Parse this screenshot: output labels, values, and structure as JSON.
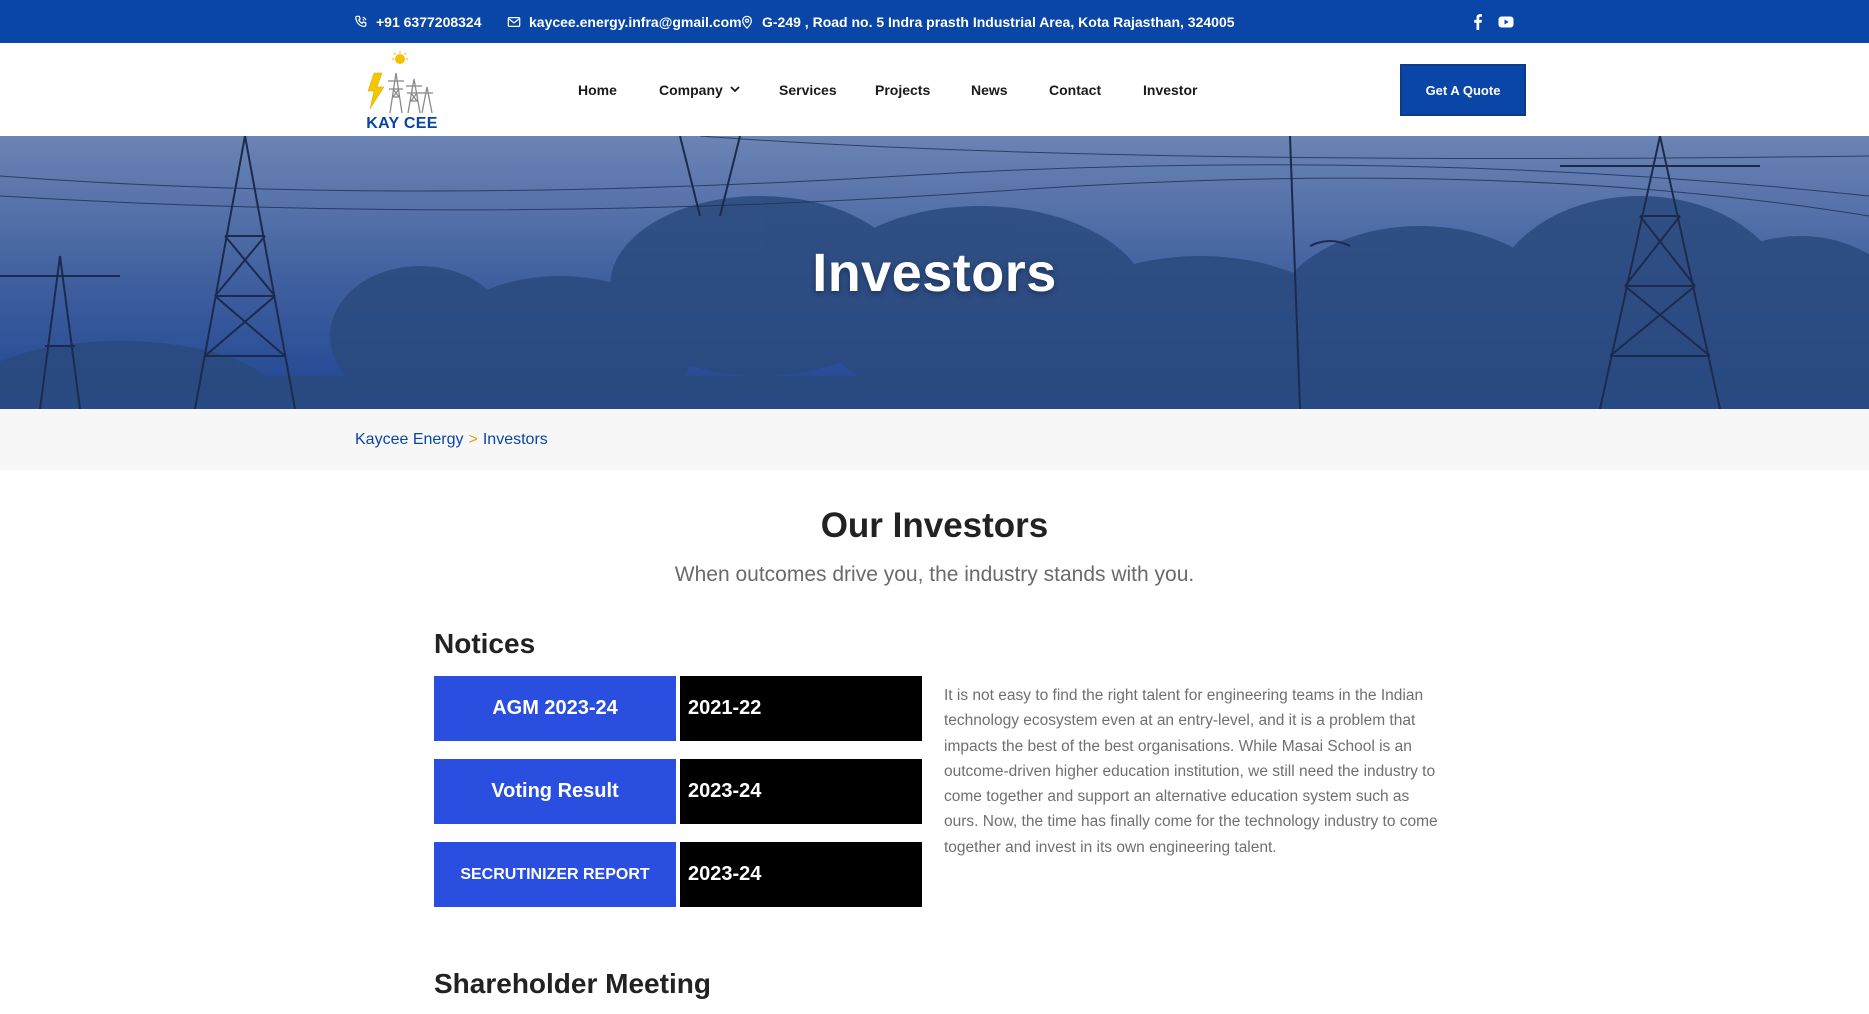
{
  "topbar": {
    "phone": "+91 6377208324",
    "email": "kaycee.energy.infra@gmail.com",
    "address": "G-249 , Road no. 5 Indra prasth Industrial Area, Kota Rajasthan, 324005",
    "icons": [
      "phone-icon",
      "mail-icon",
      "location-pin-icon",
      "facebook-icon",
      "youtube-icon"
    ]
  },
  "header": {
    "logo_text": "KAY CEE",
    "nav": [
      {
        "label": "Home"
      },
      {
        "label": "Company",
        "has_dropdown": true
      },
      {
        "label": "Services"
      },
      {
        "label": "Projects"
      },
      {
        "label": "News"
      },
      {
        "label": "Contact"
      },
      {
        "label": "Investor"
      }
    ],
    "cta": "Get A Quote"
  },
  "hero": {
    "title": "Investors"
  },
  "breadcrumb": {
    "home": "Kaycee Energy",
    "separator": ">",
    "current": "Investors"
  },
  "main": {
    "title": "Our Investors",
    "subtitle": "When outcomes drive you, the industry stands with you.",
    "notices_heading": "Notices",
    "notices": [
      {
        "label": "AGM 2023-24",
        "year": "2021-22"
      },
      {
        "label": "Voting Result",
        "year": "2023-24"
      },
      {
        "label": "SECRUTINIZER REPORT",
        "year": "2023-24"
      }
    ],
    "paragraph": "It is not easy to find the right talent for engineering teams in the Indian technology ecosystem even at an entry-level, and it is a problem that impacts the best of the best organisations. While Masai School is an outcome-driven higher education institution, we still need the industry to come together and support an alternative education system such as ours. Now, the time has finally come for the technology industry to come together and invest in its own engineering talent.",
    "shareholder_heading": "Shareholder Meeting"
  },
  "colors": {
    "brand_blue": "#0a45a8",
    "notice_blue": "#2a4ee0",
    "notice_black": "#000000",
    "breadcrumb_separator": "#e0a21b"
  }
}
